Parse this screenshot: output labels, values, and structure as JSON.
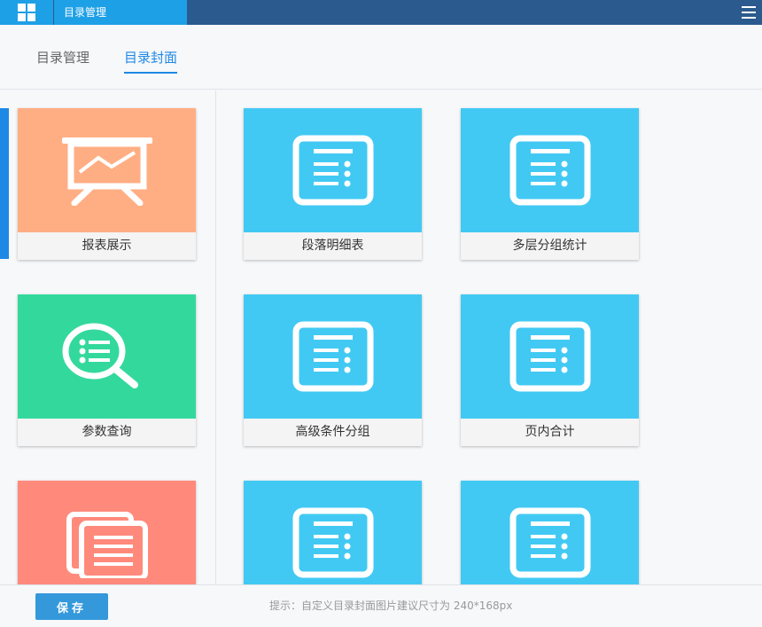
{
  "header": {
    "title": "目录管理",
    "logo_icon": "windows-grid-icon",
    "menu_icon": "hamburger-menu-icon"
  },
  "tabs": [
    {
      "label": "目录管理",
      "active": false
    },
    {
      "label": "目录封面",
      "active": true
    }
  ],
  "colors": {
    "accent": "#1e88e5",
    "topbar": "#2b5a8e",
    "tile_blue": "#42c9f3",
    "tile_orange": "#ffae84",
    "tile_green": "#33d99c",
    "tile_red": "#ff8a7c"
  },
  "left_cards": [
    {
      "label": "报表展示",
      "icon": "presentation-board-icon",
      "color": "orange"
    },
    {
      "label": "参数查询",
      "icon": "search-list-icon",
      "color": "green"
    },
    {
      "label": "",
      "icon": "stacked-documents-icon",
      "color": "red"
    }
  ],
  "right_cards": [
    {
      "label": "段落明细表",
      "icon": "document-list-icon",
      "color": "blue"
    },
    {
      "label": "多层分组统计",
      "icon": "document-list-icon",
      "color": "blue"
    },
    {
      "label": "高级条件分组",
      "icon": "document-list-icon",
      "color": "blue"
    },
    {
      "label": "页内合计",
      "icon": "document-list-icon",
      "color": "blue"
    },
    {
      "label": "",
      "icon": "document-list-icon",
      "color": "blue"
    },
    {
      "label": "",
      "icon": "document-list-icon",
      "color": "blue"
    }
  ],
  "footer": {
    "save_label": "保存",
    "hint": "提示：自定义目录封面图片建议尺寸为 240*168px"
  }
}
